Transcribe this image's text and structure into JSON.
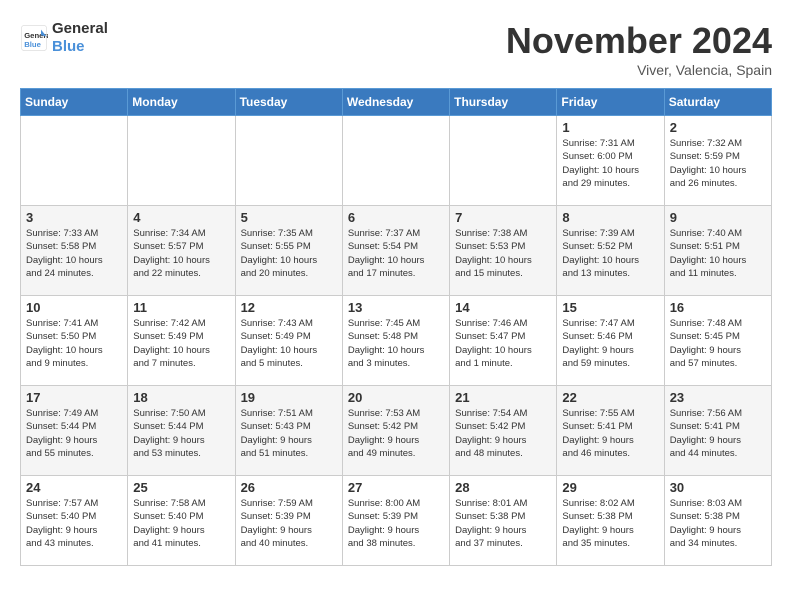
{
  "logo": {
    "line1": "General",
    "line2": "Blue"
  },
  "title": "November 2024",
  "location": "Viver, Valencia, Spain",
  "days_of_week": [
    "Sunday",
    "Monday",
    "Tuesday",
    "Wednesday",
    "Thursday",
    "Friday",
    "Saturday"
  ],
  "weeks": [
    [
      {
        "day": "",
        "info": ""
      },
      {
        "day": "",
        "info": ""
      },
      {
        "day": "",
        "info": ""
      },
      {
        "day": "",
        "info": ""
      },
      {
        "day": "",
        "info": ""
      },
      {
        "day": "1",
        "info": "Sunrise: 7:31 AM\nSunset: 6:00 PM\nDaylight: 10 hours\nand 29 minutes."
      },
      {
        "day": "2",
        "info": "Sunrise: 7:32 AM\nSunset: 5:59 PM\nDaylight: 10 hours\nand 26 minutes."
      }
    ],
    [
      {
        "day": "3",
        "info": "Sunrise: 7:33 AM\nSunset: 5:58 PM\nDaylight: 10 hours\nand 24 minutes."
      },
      {
        "day": "4",
        "info": "Sunrise: 7:34 AM\nSunset: 5:57 PM\nDaylight: 10 hours\nand 22 minutes."
      },
      {
        "day": "5",
        "info": "Sunrise: 7:35 AM\nSunset: 5:55 PM\nDaylight: 10 hours\nand 20 minutes."
      },
      {
        "day": "6",
        "info": "Sunrise: 7:37 AM\nSunset: 5:54 PM\nDaylight: 10 hours\nand 17 minutes."
      },
      {
        "day": "7",
        "info": "Sunrise: 7:38 AM\nSunset: 5:53 PM\nDaylight: 10 hours\nand 15 minutes."
      },
      {
        "day": "8",
        "info": "Sunrise: 7:39 AM\nSunset: 5:52 PM\nDaylight: 10 hours\nand 13 minutes."
      },
      {
        "day": "9",
        "info": "Sunrise: 7:40 AM\nSunset: 5:51 PM\nDaylight: 10 hours\nand 11 minutes."
      }
    ],
    [
      {
        "day": "10",
        "info": "Sunrise: 7:41 AM\nSunset: 5:50 PM\nDaylight: 10 hours\nand 9 minutes."
      },
      {
        "day": "11",
        "info": "Sunrise: 7:42 AM\nSunset: 5:49 PM\nDaylight: 10 hours\nand 7 minutes."
      },
      {
        "day": "12",
        "info": "Sunrise: 7:43 AM\nSunset: 5:49 PM\nDaylight: 10 hours\nand 5 minutes."
      },
      {
        "day": "13",
        "info": "Sunrise: 7:45 AM\nSunset: 5:48 PM\nDaylight: 10 hours\nand 3 minutes."
      },
      {
        "day": "14",
        "info": "Sunrise: 7:46 AM\nSunset: 5:47 PM\nDaylight: 10 hours\nand 1 minute."
      },
      {
        "day": "15",
        "info": "Sunrise: 7:47 AM\nSunset: 5:46 PM\nDaylight: 9 hours\nand 59 minutes."
      },
      {
        "day": "16",
        "info": "Sunrise: 7:48 AM\nSunset: 5:45 PM\nDaylight: 9 hours\nand 57 minutes."
      }
    ],
    [
      {
        "day": "17",
        "info": "Sunrise: 7:49 AM\nSunset: 5:44 PM\nDaylight: 9 hours\nand 55 minutes."
      },
      {
        "day": "18",
        "info": "Sunrise: 7:50 AM\nSunset: 5:44 PM\nDaylight: 9 hours\nand 53 minutes."
      },
      {
        "day": "19",
        "info": "Sunrise: 7:51 AM\nSunset: 5:43 PM\nDaylight: 9 hours\nand 51 minutes."
      },
      {
        "day": "20",
        "info": "Sunrise: 7:53 AM\nSunset: 5:42 PM\nDaylight: 9 hours\nand 49 minutes."
      },
      {
        "day": "21",
        "info": "Sunrise: 7:54 AM\nSunset: 5:42 PM\nDaylight: 9 hours\nand 48 minutes."
      },
      {
        "day": "22",
        "info": "Sunrise: 7:55 AM\nSunset: 5:41 PM\nDaylight: 9 hours\nand 46 minutes."
      },
      {
        "day": "23",
        "info": "Sunrise: 7:56 AM\nSunset: 5:41 PM\nDaylight: 9 hours\nand 44 minutes."
      }
    ],
    [
      {
        "day": "24",
        "info": "Sunrise: 7:57 AM\nSunset: 5:40 PM\nDaylight: 9 hours\nand 43 minutes."
      },
      {
        "day": "25",
        "info": "Sunrise: 7:58 AM\nSunset: 5:40 PM\nDaylight: 9 hours\nand 41 minutes."
      },
      {
        "day": "26",
        "info": "Sunrise: 7:59 AM\nSunset: 5:39 PM\nDaylight: 9 hours\nand 40 minutes."
      },
      {
        "day": "27",
        "info": "Sunrise: 8:00 AM\nSunset: 5:39 PM\nDaylight: 9 hours\nand 38 minutes."
      },
      {
        "day": "28",
        "info": "Sunrise: 8:01 AM\nSunset: 5:38 PM\nDaylight: 9 hours\nand 37 minutes."
      },
      {
        "day": "29",
        "info": "Sunrise: 8:02 AM\nSunset: 5:38 PM\nDaylight: 9 hours\nand 35 minutes."
      },
      {
        "day": "30",
        "info": "Sunrise: 8:03 AM\nSunset: 5:38 PM\nDaylight: 9 hours\nand 34 minutes."
      }
    ]
  ]
}
